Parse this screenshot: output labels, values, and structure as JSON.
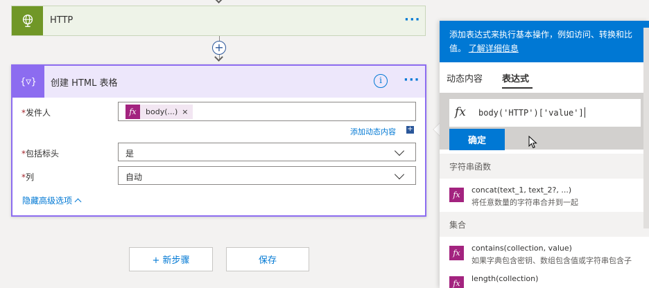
{
  "http_card": {
    "title": "HTTP",
    "more": "···"
  },
  "connector": {
    "add_symbol": "+"
  },
  "table_card": {
    "title": "创建 HTML 表格",
    "info": "i",
    "more": "···",
    "icon_text": "{▽}",
    "fields": {
      "from": {
        "label": "发件人",
        "required": "*",
        "token_fx": "fx",
        "token_text": "body(...)",
        "token_remove": "×"
      },
      "include_headers": {
        "label": "包括标头",
        "required": "*",
        "value": "是"
      },
      "columns": {
        "label": "列",
        "required": "*",
        "value": "自动"
      }
    },
    "add_dynamic": "添加动态内容",
    "add_dynamic_icon": "+",
    "hide_advanced": "隐藏高级选项"
  },
  "bottom_buttons": {
    "new_step": "+ 新步骤",
    "save": "保存"
  },
  "panel": {
    "banner_line1": "添加表达式来执行基本操作，例如访问、转换和比",
    "banner_line2": "值。",
    "banner_link": "了解详细信息",
    "tabs": [
      "动态内容",
      "表达式"
    ],
    "active_tab": "表达式",
    "expression_fx": "fx",
    "expression": "body('HTTP')['value']",
    "ok_button": "确定",
    "sections": [
      {
        "title": "字符串函数",
        "items": [
          {
            "name": "concat(text_1, text_2?, ...)",
            "desc": "将任意数量的字符串合并到一起"
          }
        ]
      },
      {
        "title": "集合",
        "items": [
          {
            "name": "contains(collection, value)",
            "desc": "如果字典包含密钥、数组包含值或字符串包含子"
          },
          {
            "name": "length(collection)",
            "desc": ""
          }
        ]
      }
    ]
  }
}
